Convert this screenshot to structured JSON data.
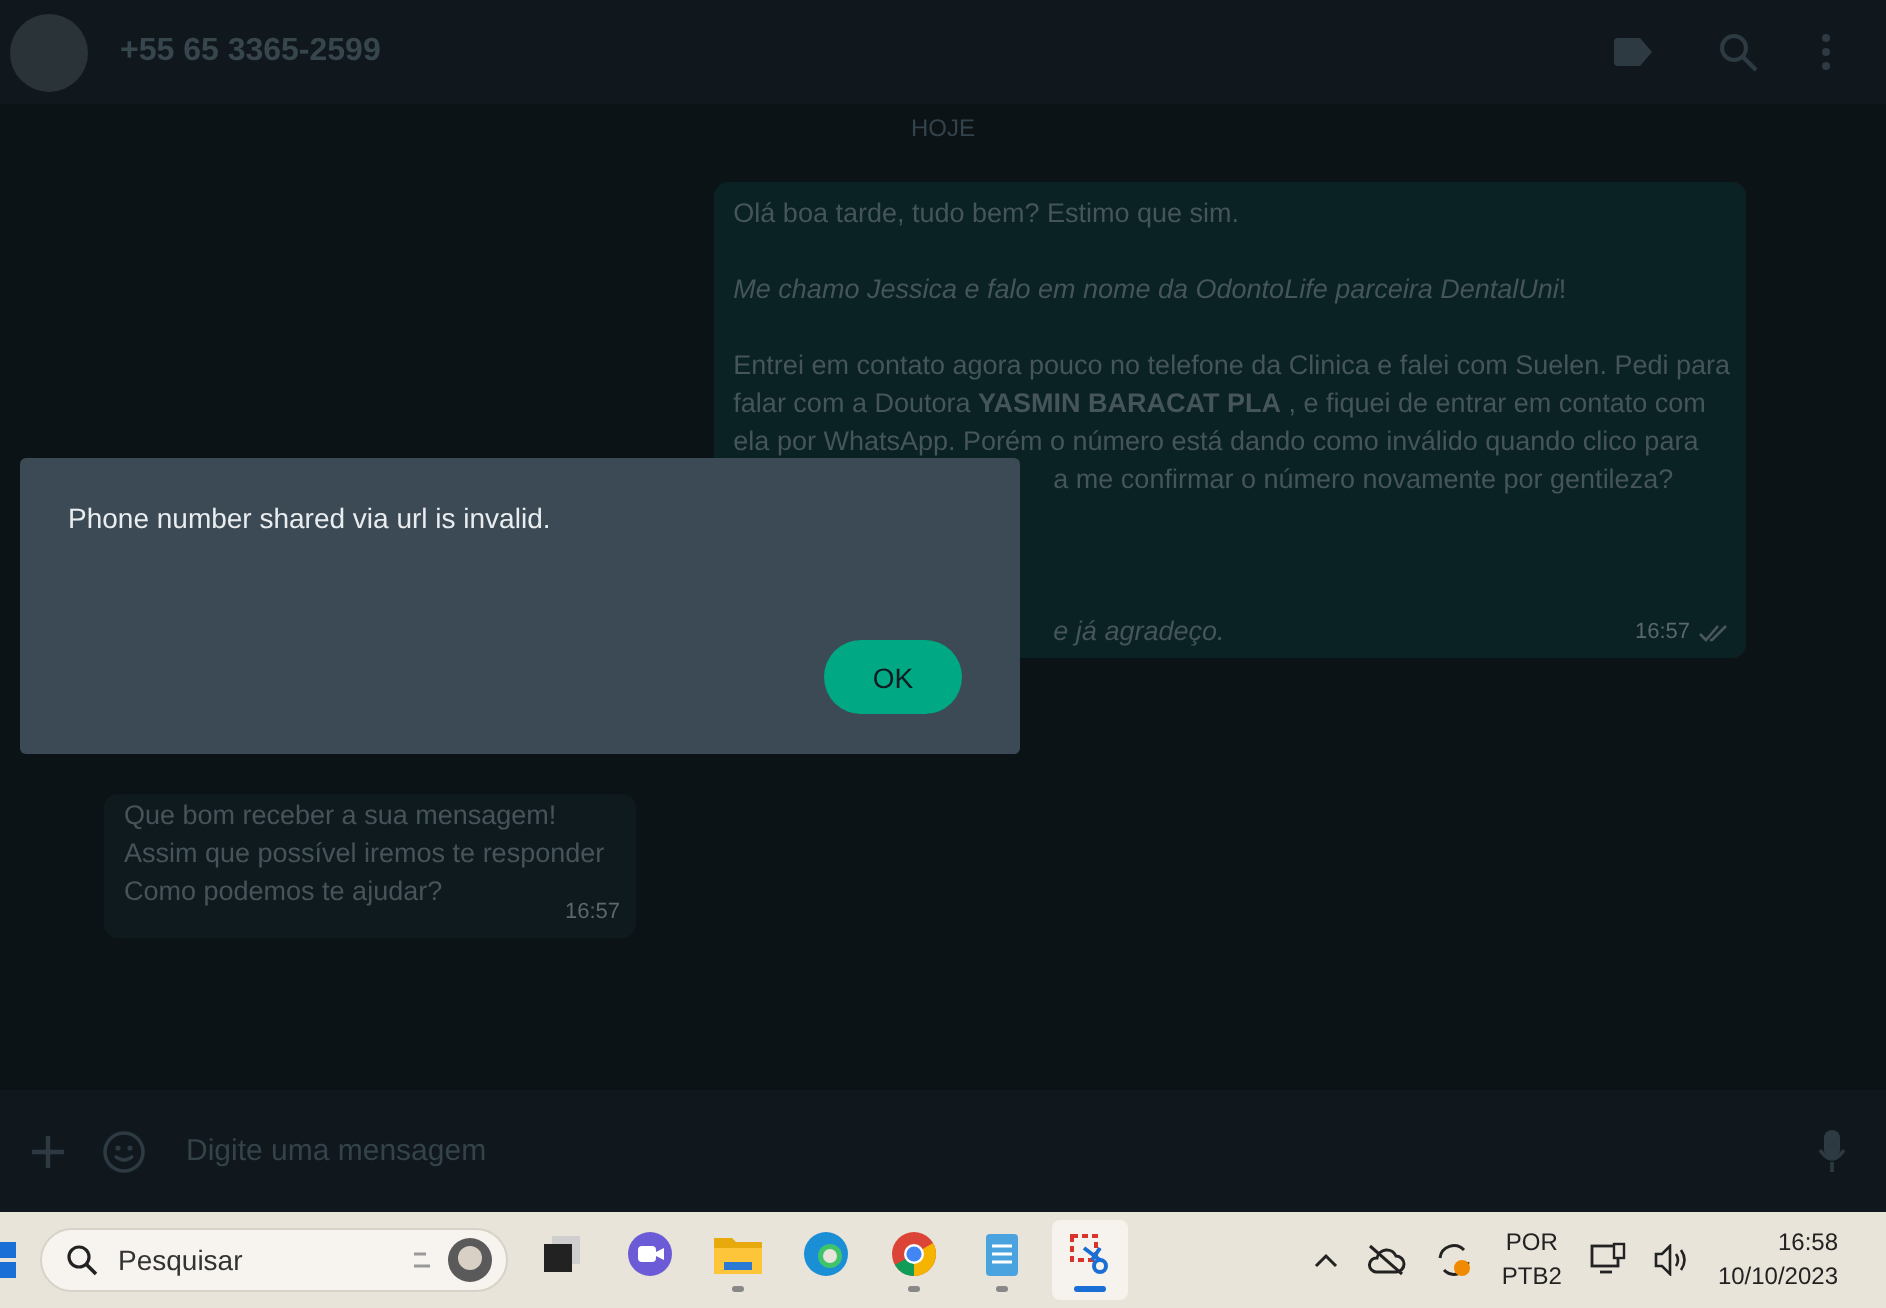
{
  "header": {
    "contact": "+55 65 3365-2599"
  },
  "day_divider": "HOJE",
  "messages": [
    {
      "kind": "outgoing",
      "time": "16:57",
      "paragraphs": [
        {
          "lines": [
            {
              "kind": "full",
              "text": "Olá boa tarde, tudo bem? Estimo que sim."
            }
          ]
        },
        {
          "lines": [
            {
              "kind": "full",
              "text": "*Me chamo Jessica e falo em nome da OdontoLife parceira DentalUni*!"
            }
          ]
        },
        {
          "lines": [
            {
              "kind": "full",
              "text": "Entrei em contato agora pouco no telefone da Clinica e falei com Suelen. Pedi para"
            },
            {
              "kind": "full",
              "text": "falar com a Doutora **YASMIN BARACAT PLA** , e fiquei de entrar em contato com"
            },
            {
              "kind": "full",
              "text": "ela por WhatsApp. Porém o número está dando como inválido quando clico para"
            },
            {
              "kind": "tail",
              "text": "a me confirmar o número novamente por gentileza?"
            }
          ]
        },
        {
          "lines": [
            {
              "kind": "tail",
              "text": "*e já agradeço.*"
            }
          ]
        }
      ]
    },
    {
      "kind": "incoming",
      "time": "16:57",
      "paragraphs": [
        {
          "lines": [
            {
              "kind": "full",
              "text": "Que bom receber a sua mensagem!"
            },
            {
              "kind": "full",
              "text": "Assim que possível iremos te responder"
            },
            {
              "kind": "full",
              "text": "Como podemos te ajudar?"
            }
          ]
        }
      ]
    }
  ],
  "composer": {
    "placeholder": "Digite uma mensagem"
  },
  "dialog": {
    "message": "Phone number shared via url is invalid.",
    "button": "OK"
  },
  "taskbar": {
    "search_placeholder": "Pesquisar",
    "apps": [
      {
        "kind": "taskview",
        "selected": false,
        "running": false
      },
      {
        "kind": "video",
        "selected": false,
        "running": false
      },
      {
        "kind": "folder",
        "selected": false,
        "running": true
      },
      {
        "kind": "edge",
        "selected": false,
        "running": false
      },
      {
        "kind": "chrome",
        "selected": false,
        "running": true
      },
      {
        "kind": "notepad",
        "selected": false,
        "running": true
      },
      {
        "kind": "snip",
        "selected": true,
        "running": true
      }
    ],
    "language": "POR",
    "layout": "PTB2",
    "time": "16:58",
    "date": "10/10/2023"
  }
}
